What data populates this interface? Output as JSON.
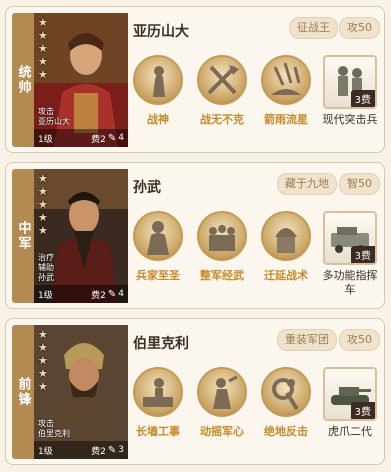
{
  "colors": {
    "accent_gold": "#c68a2a",
    "side_bar": "#b38a52",
    "tag_bg": "#efe3cd",
    "tag_text": "#a07c52"
  },
  "cards": [
    {
      "position": "统帅",
      "name": "亚历山大",
      "stars": 5,
      "traits": [
        "攻击",
        "亚历山大"
      ],
      "level": "1级",
      "cost": "费2",
      "brush_count": "4",
      "tags": [
        "征战王",
        "攻50"
      ],
      "skills": [
        {
          "label": "战神",
          "icon": "warrior-statue-icon"
        },
        {
          "label": "战无不克",
          "icon": "crossed-axes-icon"
        },
        {
          "label": "箭雨流星",
          "icon": "arrow-rain-icon"
        }
      ],
      "unit": {
        "label": "现代突击兵",
        "cost": "3费",
        "icon": "assault-soldiers-icon"
      }
    },
    {
      "position": "中军",
      "name": "孙武",
      "stars": 5,
      "traits": [
        "治疗",
        "辅助",
        "孙武"
      ],
      "level": "1级",
      "cost": "费2",
      "brush_count": "4",
      "tags": [
        "藏于九地",
        "智50"
      ],
      "skills": [
        {
          "label": "兵家至圣",
          "icon": "strategist-statue-icon"
        },
        {
          "label": "整军经武",
          "icon": "army-formation-icon"
        },
        {
          "label": "迁延战术",
          "icon": "helmet-soldier-icon"
        }
      ],
      "unit": {
        "label": "多功能指挥车",
        "cost": "3费",
        "icon": "command-vehicle-icon"
      }
    },
    {
      "position": "前锋",
      "name": "伯里克利",
      "stars": 5,
      "traits": [
        "攻击",
        "伯里克利"
      ],
      "level": "1级",
      "cost": "费2",
      "brush_count": "3",
      "tags": [
        "重装军团",
        "攻50"
      ],
      "skills": [
        {
          "label": "长墙工事",
          "icon": "wall-builder-icon"
        },
        {
          "label": "动摇军心",
          "icon": "shaking-morale-icon"
        },
        {
          "label": "绝地反击",
          "icon": "counter-attack-icon"
        }
      ],
      "unit": {
        "label": "虎爪二代",
        "cost": "3费",
        "icon": "tank-icon"
      }
    }
  ]
}
